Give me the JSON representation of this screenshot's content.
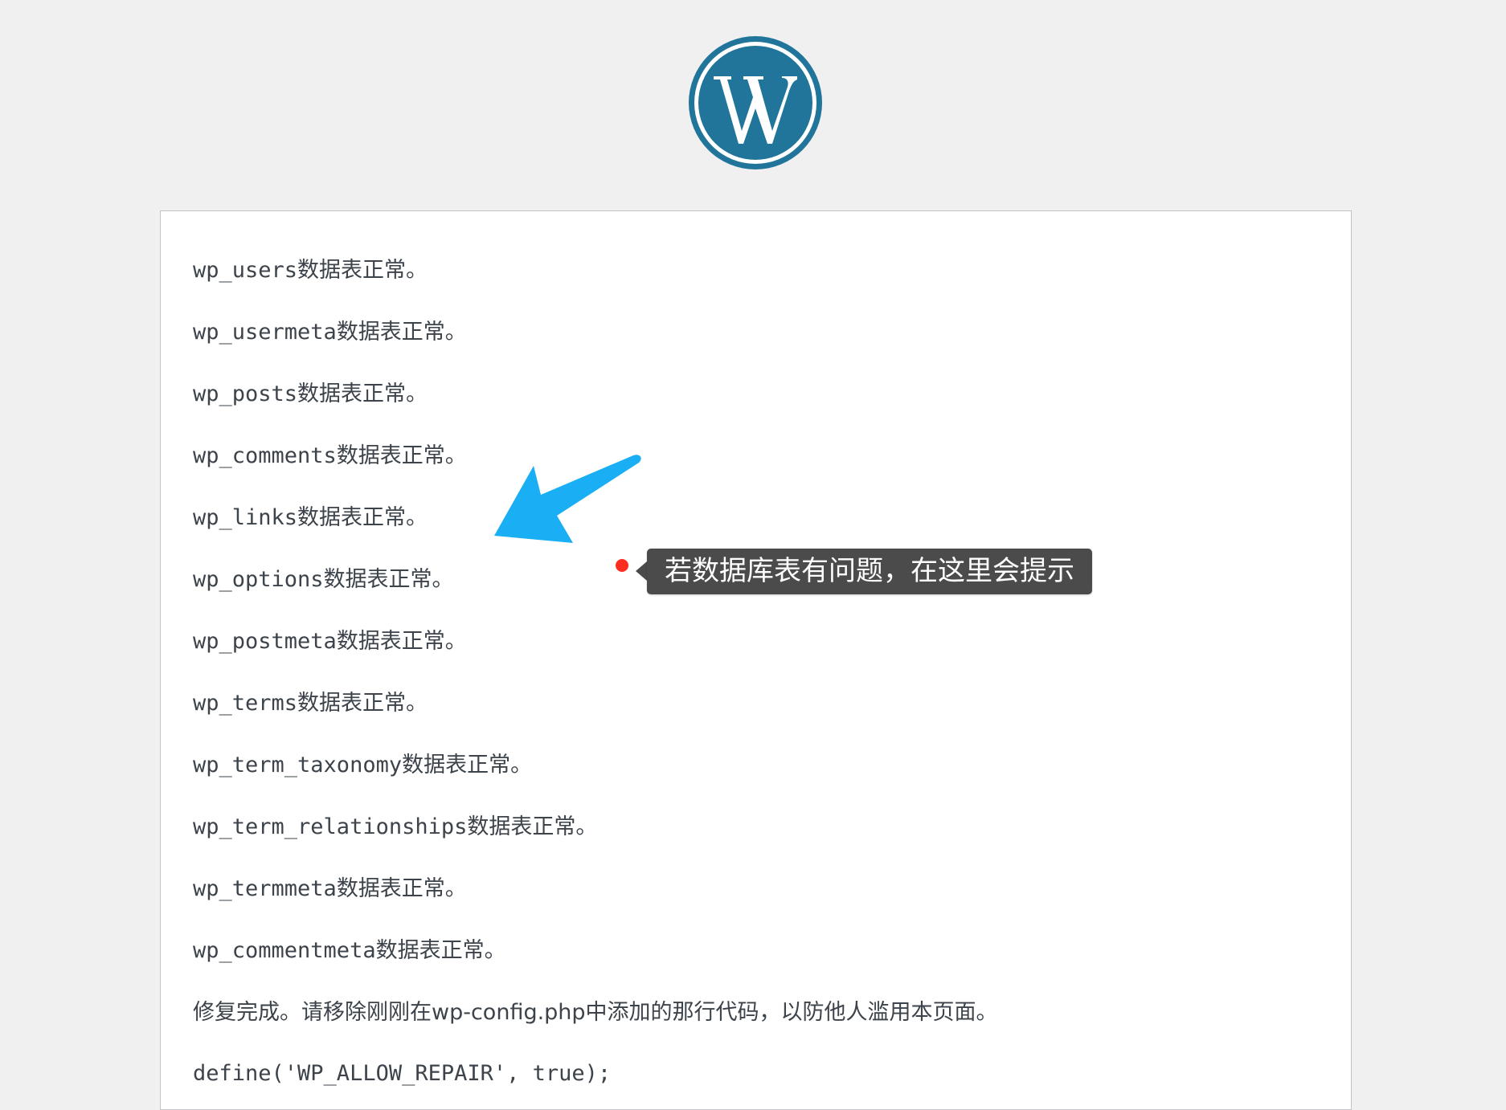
{
  "brand": {
    "logo_name": "wordpress-logo",
    "logo_color": "#21759b"
  },
  "content": {
    "lines": [
      {
        "code": "wp_users",
        "status": "数据表正常。"
      },
      {
        "code": "wp_usermeta",
        "status": "数据表正常。"
      },
      {
        "code": "wp_posts",
        "status": "数据表正常。"
      },
      {
        "code": "wp_comments",
        "status": "数据表正常。"
      },
      {
        "code": "wp_links",
        "status": "数据表正常。"
      },
      {
        "code": "wp_options",
        "status": "数据表正常。"
      },
      {
        "code": "wp_postmeta",
        "status": "数据表正常。"
      },
      {
        "code": "wp_terms",
        "status": "数据表正常。"
      },
      {
        "code": "wp_term_taxonomy",
        "status": "数据表正常。"
      },
      {
        "code": "wp_term_relationships",
        "status": "数据表正常。"
      },
      {
        "code": "wp_termmeta",
        "status": "数据表正常。"
      },
      {
        "code": "wp_commentmeta",
        "status": "数据表正常。"
      }
    ],
    "repair_notice": "修复完成。请移除刚刚在wp-config.php中添加的那行代码，以防他人滥用本页面。",
    "define_line": "define('WP_ALLOW_REPAIR', true);"
  },
  "annotation": {
    "tooltip_text": "若数据库表有问题，在这里会提示",
    "arrow_color": "#1aaef5",
    "dot_color": "#ff2d20",
    "tooltip_bg": "#4b4b4b"
  }
}
